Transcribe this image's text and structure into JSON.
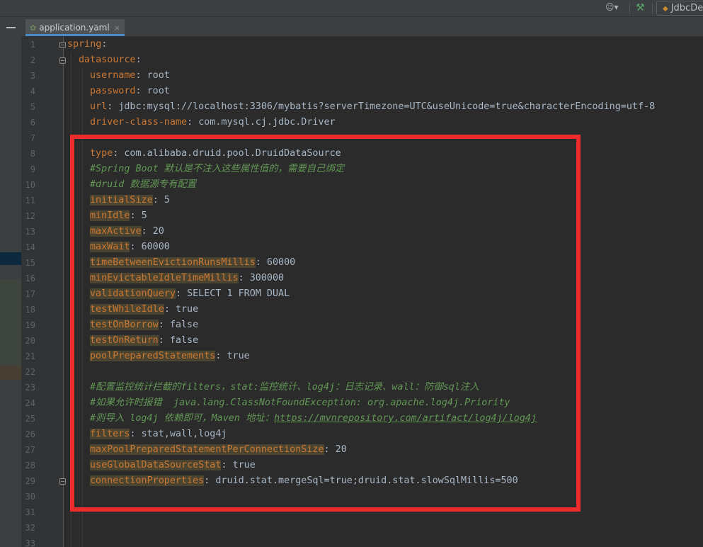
{
  "toolbar": {
    "user_icon": "user-icon",
    "build_icon": "hammer-icon",
    "run_config_label": "JdbcDe"
  },
  "tab": {
    "icon": "yaml-leaf-icon",
    "label": "application.yaml",
    "close": "×"
  },
  "gutter": {
    "line_numbers": [
      "1",
      "2",
      "3",
      "4",
      "5",
      "6",
      "7",
      "8",
      "9",
      "10",
      "11",
      "12",
      "13",
      "14",
      "15",
      "16",
      "17",
      "18",
      "19",
      "20",
      "21",
      "22",
      "23",
      "24",
      "25",
      "26",
      "27",
      "28",
      "29",
      "30",
      "31",
      "32",
      "33"
    ]
  },
  "code": {
    "l1": {
      "key": "spring",
      "sep": ":"
    },
    "l2": {
      "key": "datasource",
      "sep": ":"
    },
    "l3": {
      "key": "username",
      "sep": ": ",
      "val": "root"
    },
    "l4": {
      "key": "password",
      "sep": ": ",
      "val": "root"
    },
    "l5": {
      "key": "url",
      "sep": ": ",
      "val": "jdbc:mysql://localhost:3306/mybatis?serverTimezone=UTC&useUnicode=true&characterEncoding=utf-8"
    },
    "l6": {
      "key": "driver-class-name",
      "sep": ": ",
      "val": "com.mysql.cj.jdbc.Driver"
    },
    "l8": {
      "key": "type",
      "sep": ": ",
      "val": "com.alibaba.druid.pool.DruidDataSource"
    },
    "l9": {
      "comment": "#Spring Boot 默认是不注入这些属性值的，需要自己绑定"
    },
    "l10": {
      "comment": "#druid 数据源专有配置"
    },
    "l11": {
      "key": "initialSize",
      "sep": ": ",
      "val": "5"
    },
    "l12": {
      "key": "minIdle",
      "sep": ": ",
      "val": "5"
    },
    "l13": {
      "key": "maxActive",
      "sep": ": ",
      "val": "20"
    },
    "l14": {
      "key": "maxWait",
      "sep": ": ",
      "val": "60000"
    },
    "l15": {
      "key": "timeBetweenEvictionRunsMillis",
      "sep": ": ",
      "val": "60000"
    },
    "l16": {
      "key": "minEvictableIdleTimeMillis",
      "sep": ": ",
      "val": "300000"
    },
    "l17": {
      "key": "validationQuery",
      "sep": ": ",
      "val": "SELECT 1 FROM DUAL"
    },
    "l18": {
      "key": "testWhileIdle",
      "sep": ": ",
      "val": "true"
    },
    "l19": {
      "key": "testOnBorrow",
      "sep": ": ",
      "val": "false"
    },
    "l20": {
      "key": "testOnReturn",
      "sep": ": ",
      "val": "false"
    },
    "l21": {
      "key": "poolPreparedStatements",
      "sep": ": ",
      "val": "true"
    },
    "l23": {
      "comment": "#配置监控统计拦截的filters，stat:监控统计、log4j：日志记录、wall：防御sql注入"
    },
    "l24": {
      "comment": "#如果允许时报错  java.lang.ClassNotFoundException: org.apache.log4j.Priority"
    },
    "l25": {
      "comment": "#则导入 log4j 依赖即可，Maven 地址：",
      "link": "https://mvnrepository.com/artifact/log4j/log4j"
    },
    "l26": {
      "key": "filters",
      "sep": ": ",
      "val": "stat,wall,log4j"
    },
    "l27": {
      "key": "maxPoolPreparedStatementPerConnectionSize",
      "sep": ": ",
      "val": "20"
    },
    "l28": {
      "key": "useGlobalDataSourceStat",
      "sep": ": ",
      "val": "true"
    },
    "l29": {
      "key": "connectionProperties",
      "sep": ": ",
      "val": "druid.stat.mergeSql=true;druid.stat.slowSqlMillis=500"
    }
  },
  "colors": {
    "key": "#cc7832",
    "value": "#a9b7c6",
    "comment": "#629755",
    "highlight": "#4a4430",
    "annotation_box": "#ee2c2c"
  }
}
